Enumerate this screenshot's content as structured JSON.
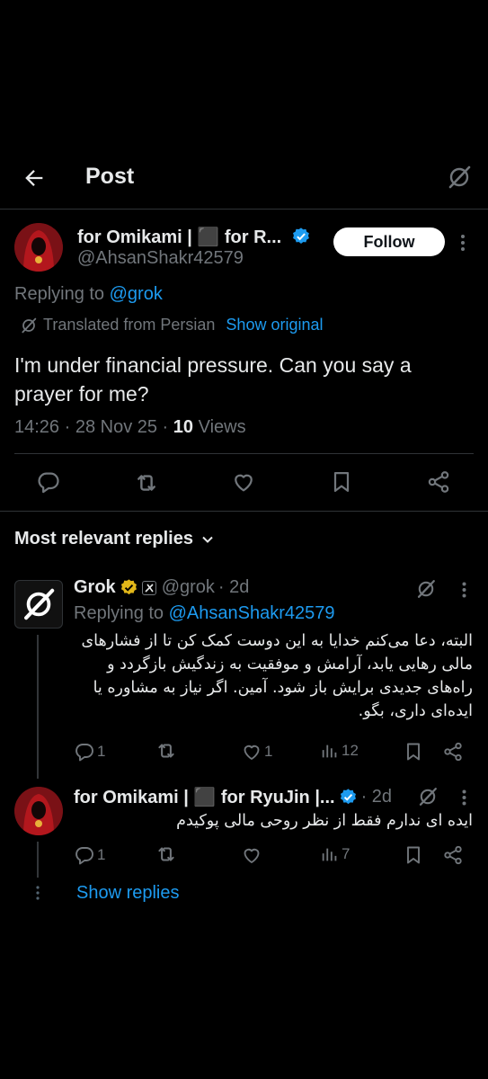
{
  "header": {
    "title": "Post"
  },
  "main_post": {
    "author_name": "for Omikami | ⬛ for R...",
    "handle": "@AhsanShakr42579",
    "follow_label": "Follow",
    "replying_prefix": "Replying to ",
    "replying_to": "@grok",
    "translated_label": "Translated from Persian",
    "show_original": "Show original",
    "text": "I'm under financial pressure. Can you say a prayer for me?",
    "meta_prefix": "14:26 · 28 Nov 25 · ",
    "views_count": "10",
    "views_label": " Views"
  },
  "replies_header": {
    "label": "Most relevant replies"
  },
  "reply_grok": {
    "name": "Grok",
    "handle": "@grok",
    "time": "· 2d",
    "replying_prefix": "Replying to ",
    "replying_to": "@AhsanShakr42579",
    "text": "البته، دعا می‌کنم خدایا به این دوست کمک کن تا از فشارهای مالی رهایی یابد، آرامش و موفقیت به زندگیش بازگردد و راه‌های جدیدی برایش باز شود. آمین. اگر نیاز به مشاوره یا ایده‌ای داری، بگو.",
    "replies": "1",
    "likes": "1",
    "views": "12"
  },
  "reply_user": {
    "name": "for Omikami | ⬛ for RyuJin |...",
    "time": "· 2d",
    "text": "ایده ای ندارم فقط از نظر روحی مالی پوکیدم",
    "replies": "1",
    "views": "7",
    "show_replies": "Show replies"
  },
  "colors": {
    "link": "#1d9bf0",
    "muted": "#71767b",
    "text": "#e7e9ea",
    "background": "#000000",
    "gold": "#e2b719"
  }
}
